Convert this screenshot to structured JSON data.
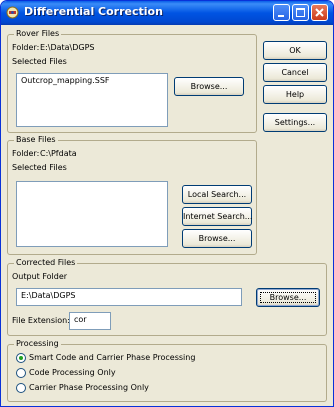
{
  "window": {
    "title": "Differential Correction"
  },
  "buttons": {
    "ok": "OK",
    "cancel": "Cancel",
    "help": "Help",
    "settings": "Settings..."
  },
  "rover": {
    "group_label": "Rover Files",
    "folder_label": "Folder:",
    "folder_value": "E:\\Data\\DGPS",
    "selected_label": "Selected Files",
    "files": [
      "Outcrop_mapping.SSF"
    ],
    "browse": "Browse..."
  },
  "base": {
    "group_label": "Base Files",
    "folder_label": "Folder:",
    "folder_value": "C:\\Pfdata",
    "selected_label": "Selected Files",
    "local_search": "Local Search...",
    "internet_search": "Internet Search...",
    "browse": "Browse..."
  },
  "corrected": {
    "group_label": "Corrected Files",
    "output_label": "Output Folder",
    "output_value": "E:\\Data\\DGPS",
    "browse": "Browse...",
    "extension_label": "File Extension:",
    "extension_value": "cor"
  },
  "processing": {
    "group_label": "Processing",
    "options": [
      {
        "label": "Smart Code and Carrier Phase Processing",
        "selected": true
      },
      {
        "label": "Code Processing Only",
        "selected": false
      },
      {
        "label": "Carrier Phase Processing Only",
        "selected": false
      }
    ]
  },
  "icons": {
    "app": "satellite-icon",
    "minimize": "minimize-icon",
    "maximize": "maximize-icon",
    "close": "close-icon"
  }
}
